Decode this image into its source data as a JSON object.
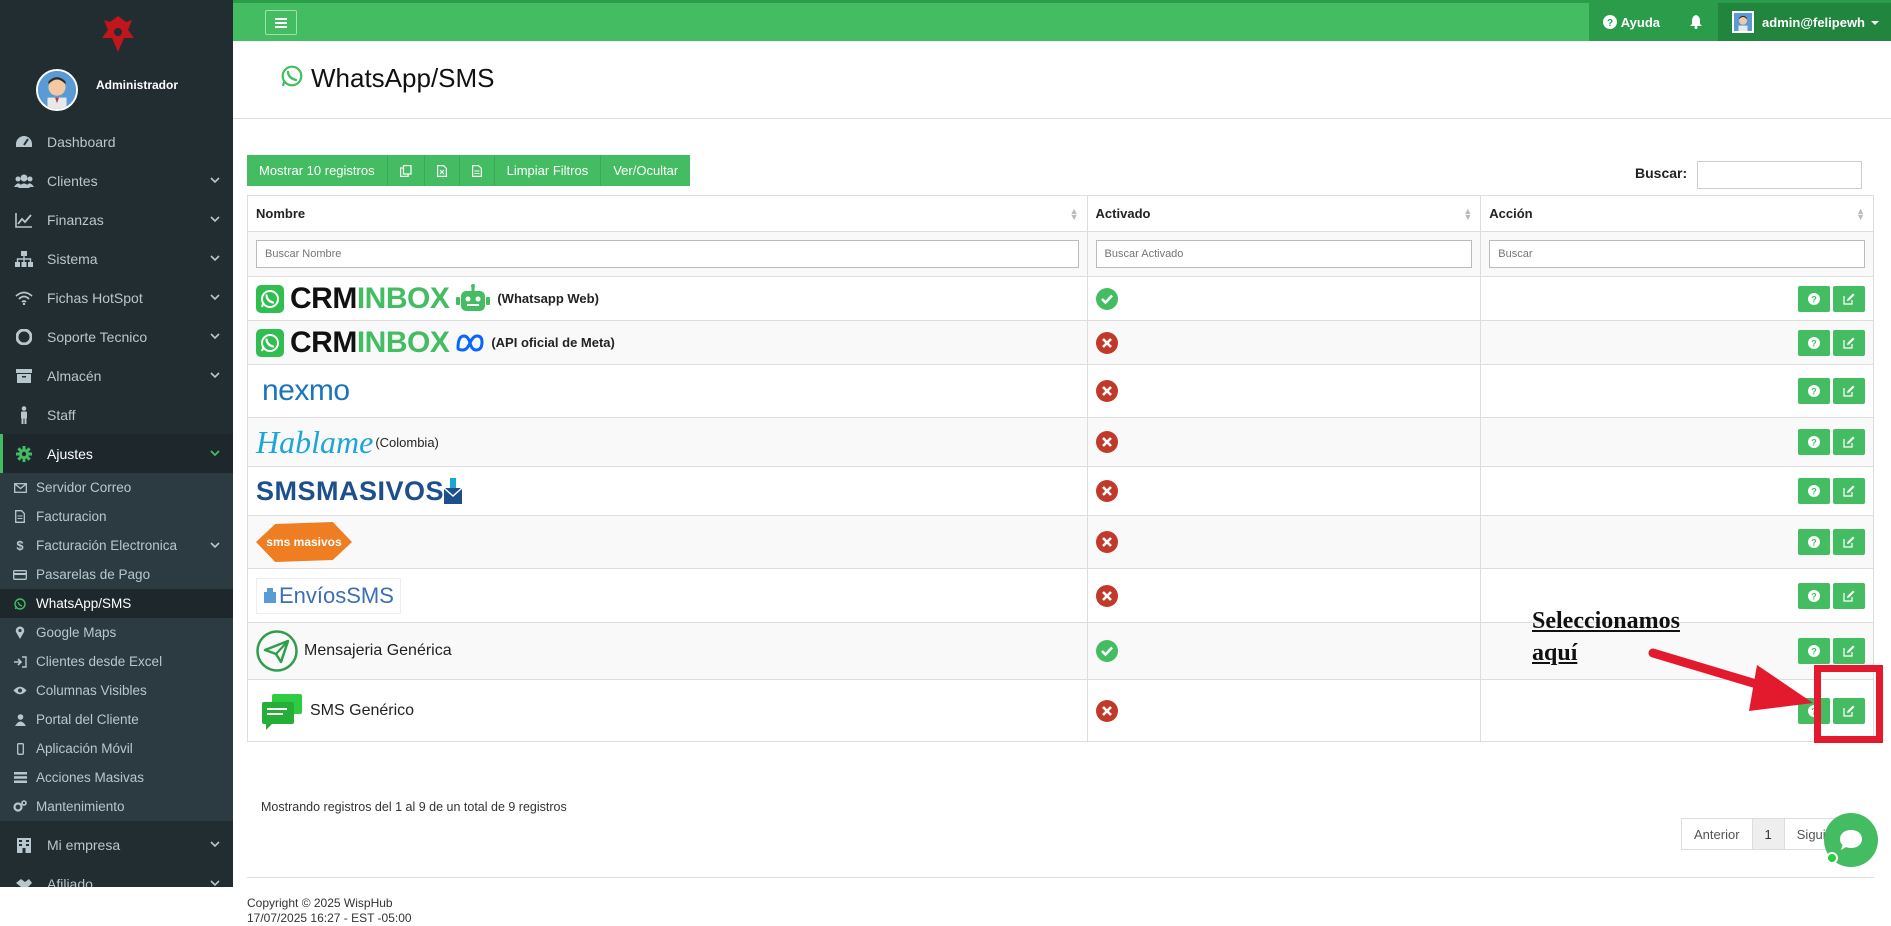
{
  "sidebar": {
    "user_name": "Administrador",
    "items": [
      {
        "label": "Dashboard",
        "icon": "dashboard-icon",
        "chevron": false
      },
      {
        "label": "Clientes",
        "icon": "users-icon",
        "chevron": true
      },
      {
        "label": "Finanzas",
        "icon": "chart-line-icon",
        "chevron": true
      },
      {
        "label": "Sistema",
        "icon": "sitemap-icon",
        "chevron": true
      },
      {
        "label": "Fichas HotSpot",
        "icon": "wifi-icon",
        "chevron": true
      },
      {
        "label": "Soporte Tecnico",
        "icon": "support-icon",
        "chevron": true
      },
      {
        "label": "Almacén",
        "icon": "archive-icon",
        "chevron": true
      },
      {
        "label": "Staff",
        "icon": "person-icon",
        "chevron": false
      },
      {
        "label": "Ajustes",
        "icon": "gear-icon",
        "chevron": true
      }
    ],
    "subitems": [
      {
        "label": "Servidor Correo",
        "icon": "envelope-icon"
      },
      {
        "label": "Facturacion",
        "icon": "file-icon"
      },
      {
        "label": "Facturación Electronica",
        "icon": "dollar-icon"
      },
      {
        "label": "Pasarelas de Pago",
        "icon": "credit-card-icon"
      },
      {
        "label": "WhatsApp/SMS",
        "icon": "whatsapp-icon"
      },
      {
        "label": "Google Maps",
        "icon": "map-pin-icon"
      },
      {
        "label": "Clientes desde Excel",
        "icon": "sign-in-icon"
      },
      {
        "label": "Columnas Visibles",
        "icon": "eye-icon"
      },
      {
        "label": "Portal del Cliente",
        "icon": "user-icon"
      },
      {
        "label": "Aplicación Móvil",
        "icon": "mobile-icon"
      },
      {
        "label": "Acciones Masivas",
        "icon": "tasks-icon"
      },
      {
        "label": "Mantenimiento",
        "icon": "cogs-icon"
      }
    ],
    "bottom_items": [
      {
        "label": "Mi empresa",
        "icon": "building-icon"
      },
      {
        "label": "Afiliado",
        "icon": "handshake-icon"
      }
    ]
  },
  "topbar": {
    "help_label": "Ayuda",
    "user_label": "admin@felipewh"
  },
  "page": {
    "title": "WhatsApp/SMS"
  },
  "toolbar": {
    "show_label": "Mostrar 10 registros",
    "clear_filters_label": "Limpiar Filtros",
    "toggle_label": "Ver/Ocultar",
    "search_label": "Buscar:"
  },
  "table": {
    "headers": [
      "Nombre",
      "Activado",
      "Acción"
    ],
    "filter_placeholders": [
      "Buscar Nombre",
      "Buscar Activado",
      "Buscar"
    ],
    "rows": [
      {
        "logo": "CRMINBOX",
        "extra": "(Whatsapp Web)",
        "active": true
      },
      {
        "logo": "CRMINBOX",
        "extra": "(API oficial de Meta)",
        "active": false
      },
      {
        "logo": "nexmo",
        "extra": "",
        "active": false
      },
      {
        "logo": "Hablame",
        "extra": "(Colombia)",
        "active": false
      },
      {
        "logo": "SMSMASIVOS",
        "extra": "",
        "active": false
      },
      {
        "logo": "sms masivos",
        "extra": "",
        "active": false
      },
      {
        "logo": "EnvíosSMS",
        "extra": "",
        "active": false
      },
      {
        "logo": "",
        "extra": "Mensajeria Genérica",
        "active": true
      },
      {
        "logo": "",
        "extra": "SMS Genérico",
        "active": false
      }
    ]
  },
  "info_text": "Mostrando registros del 1 al 9 de un total de 9 registros",
  "pagination": {
    "prev": "Anterior",
    "current": "1",
    "next": "Siguiente"
  },
  "footer": {
    "copyright": "Copyright © 2025 WispHub",
    "timestamp": "17/07/2025 16:27 - EST -05:00"
  },
  "annotation": {
    "line1": "Seleccionamos",
    "line2": "aquí",
    "color": "#e3192e"
  },
  "colors": {
    "accent": "#44bd62",
    "sidebar_bg": "#222d32",
    "danger": "#c9302c"
  }
}
